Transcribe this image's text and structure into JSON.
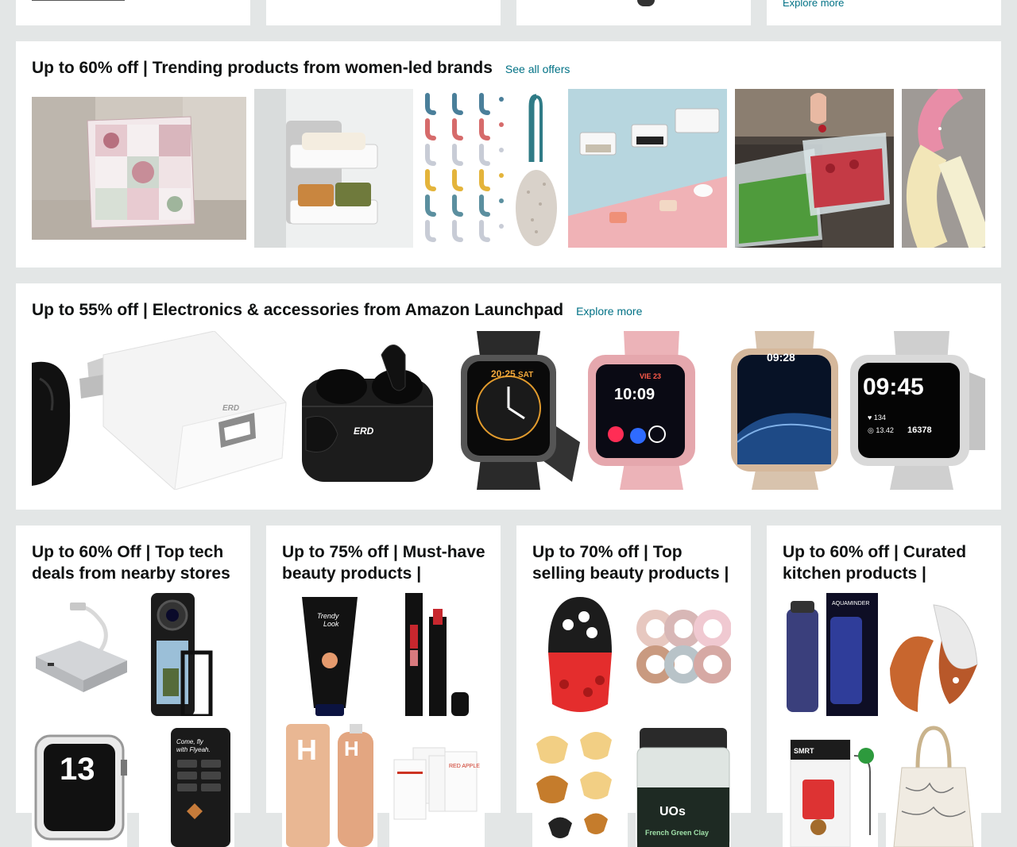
{
  "top_row": {
    "explore_label": "Explore more"
  },
  "women_brands": {
    "title": "Up to 60% off | Trending products from women-led brands",
    "link_label": "See all offers",
    "products": [
      {
        "name": "Patchwork print cushion cover",
        "icon": "cushion-icon"
      },
      {
        "name": "Wall-mounted double soap holder",
        "icon": "soap-holder-icon"
      },
      {
        "name": "Adhesive wall hooks set",
        "icon": "wall-hooks-icon"
      },
      {
        "name": "Pumice stone foot scrubber",
        "icon": "pumice-icon"
      },
      {
        "name": "Wall soap dish set",
        "icon": "soap-dish-icon"
      },
      {
        "name": "Fridge storage containers",
        "icon": "containers-icon"
      },
      {
        "name": "Flower garland decoration",
        "icon": "garland-icon"
      }
    ]
  },
  "launchpad": {
    "title": "Up to 55% off | Electronics & accessories from Amazon Launchpad",
    "link_label": "Explore more",
    "brand": "ERD",
    "watch_times": [
      "20:25",
      "10:09",
      "09:28",
      "09:45"
    ],
    "watch_extra": {
      "day": "SAT",
      "date": "VIE 23",
      "steps": "16378"
    }
  },
  "grid_cards": [
    {
      "title": "Up to 60% Off | Top tech deals from nearby stores"
    },
    {
      "title": "Up to 75% off | Must-have beauty products |"
    },
    {
      "title": "Up to 70% off | Top selling beauty products |"
    },
    {
      "title": "Up to 60% off | Curated kitchen products |"
    }
  ],
  "colors": {
    "background": "#e3e6e6",
    "link": "#007185",
    "card": "#ffffff"
  }
}
